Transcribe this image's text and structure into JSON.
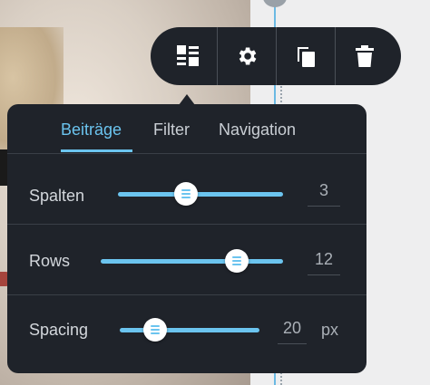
{
  "toolbar": {
    "buttons": [
      {
        "icon": "layout-icon"
      },
      {
        "icon": "gear-icon"
      },
      {
        "icon": "copy-icon"
      },
      {
        "icon": "trash-icon"
      }
    ]
  },
  "tabs": [
    {
      "label": "Beiträge",
      "active": true
    },
    {
      "label": "Filter",
      "active": false
    },
    {
      "label": "Navigation",
      "active": false
    }
  ],
  "settings": {
    "spalten": {
      "label": "Spalten",
      "value": "3",
      "fraction": 0.42
    },
    "rows": {
      "label": "Rows",
      "value": "12",
      "fraction": 0.75
    },
    "spacing": {
      "label": "Spacing",
      "value": "20",
      "unit": "px",
      "fraction": 0.25
    }
  },
  "colors": {
    "accent": "#6bc4ef",
    "panel": "#1f232a"
  }
}
